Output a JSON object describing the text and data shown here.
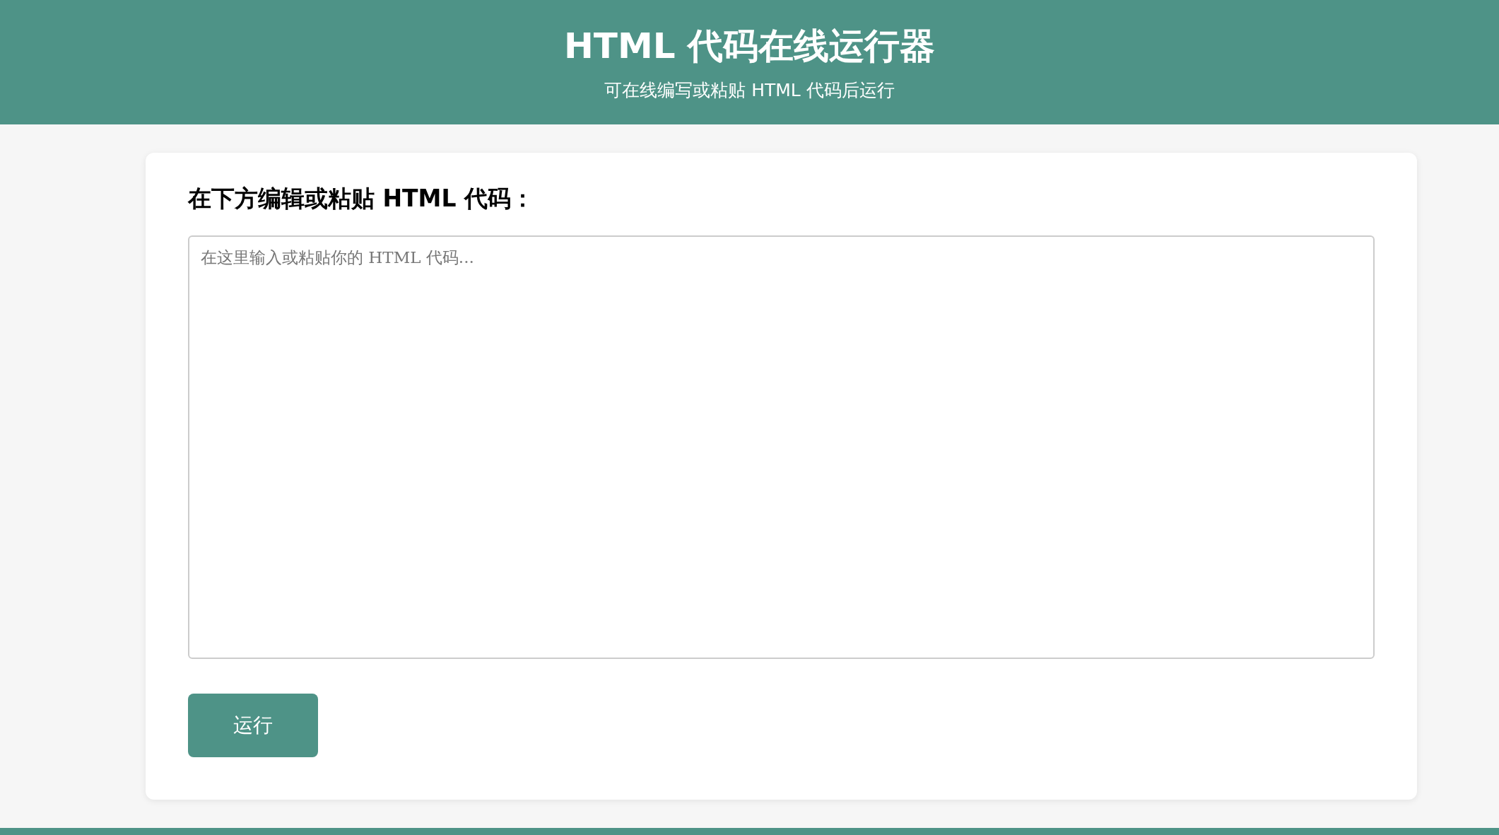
{
  "header": {
    "title": "HTML 代码在线运行器",
    "subtitle": "可在线编写或粘贴 HTML 代码后运行"
  },
  "editor": {
    "label": "在下方编辑或粘贴 HTML 代码：",
    "placeholder": "在这里输入或粘贴你的 HTML 代码..."
  },
  "run_button": {
    "label": "运行"
  }
}
